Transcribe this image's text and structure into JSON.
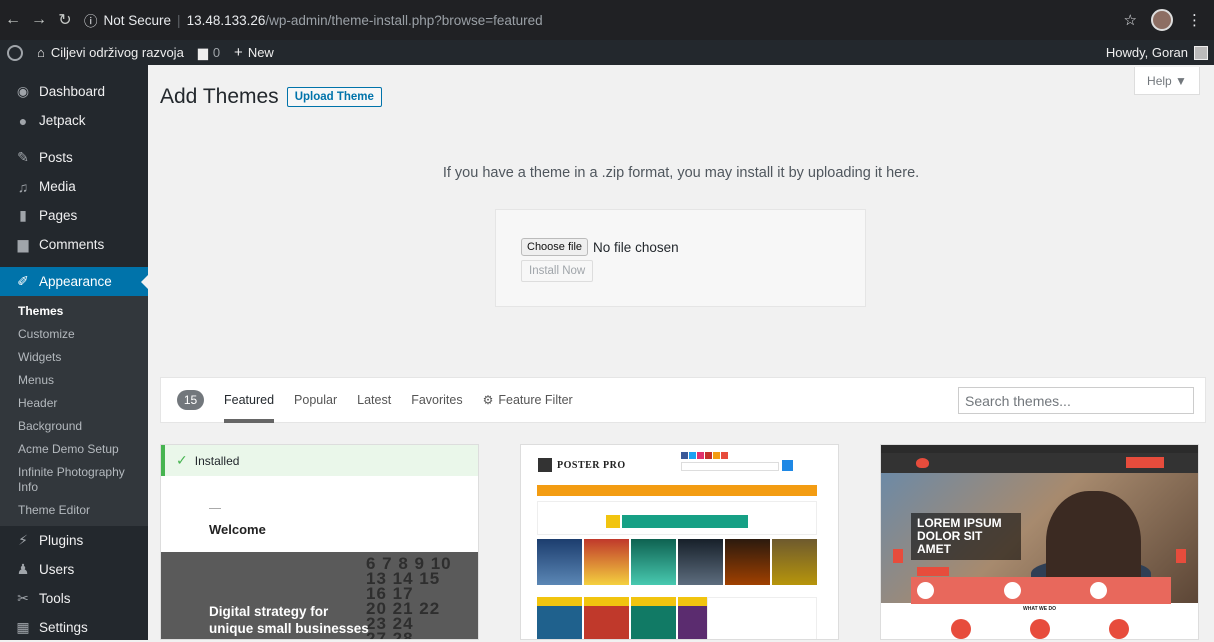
{
  "browser": {
    "security": "Not Secure",
    "url_host": "13.48.133.26",
    "url_path": "/wp-admin/theme-install.php?browse=featured"
  },
  "adminbar": {
    "site_name": "Ciljevi održivog razvoja",
    "comments_count": "0",
    "new_label": "New",
    "howdy": "Howdy, Goran"
  },
  "sidebar": {
    "items_top": [
      {
        "label": "Dashboard",
        "icon": "dashboard-icon"
      },
      {
        "label": "Jetpack",
        "icon": "jetpack-icon"
      }
    ],
    "items_mid": [
      {
        "label": "Posts",
        "icon": "pin-icon"
      },
      {
        "label": "Media",
        "icon": "media-icon"
      },
      {
        "label": "Pages",
        "icon": "pages-icon"
      },
      {
        "label": "Comments",
        "icon": "comment-icon"
      }
    ],
    "appearance": "Appearance",
    "submenu": [
      "Themes",
      "Customize",
      "Widgets",
      "Menus",
      "Header",
      "Background",
      "Acme Demo Setup",
      "Infinite Photography Info",
      "Theme Editor"
    ],
    "items_bottom": [
      {
        "label": "Plugins",
        "icon": "plugin-icon"
      },
      {
        "label": "Users",
        "icon": "users-icon"
      },
      {
        "label": "Tools",
        "icon": "tools-icon"
      },
      {
        "label": "Settings",
        "icon": "settings-icon"
      }
    ]
  },
  "page": {
    "help": "Help ▼",
    "title": "Add Themes",
    "upload_button": "Upload Theme",
    "upload_message": "If you have a theme in a .zip format, you may install it by uploading it here.",
    "choose_file": "Choose file",
    "no_file": "No file chosen",
    "install_now": "Install Now"
  },
  "filter": {
    "count": "15",
    "tabs": [
      "Featured",
      "Popular",
      "Latest",
      "Favorites"
    ],
    "feature_filter": "Feature Filter",
    "search_placeholder": "Search themes..."
  },
  "themes": {
    "card1": {
      "installed": "Installed",
      "welcome": "Welcome",
      "tagline": "Digital strategy for unique small businesses"
    },
    "card2": {
      "title": "POSTER PRO"
    },
    "card3": {
      "hero": "LOREM IPSUM DOLOR SIT AMET",
      "section": "WHAT WE DO"
    }
  },
  "colors": {
    "wp_blue": "#0073aa",
    "admin_dark": "#23282d",
    "installed_green": "#46b450"
  }
}
